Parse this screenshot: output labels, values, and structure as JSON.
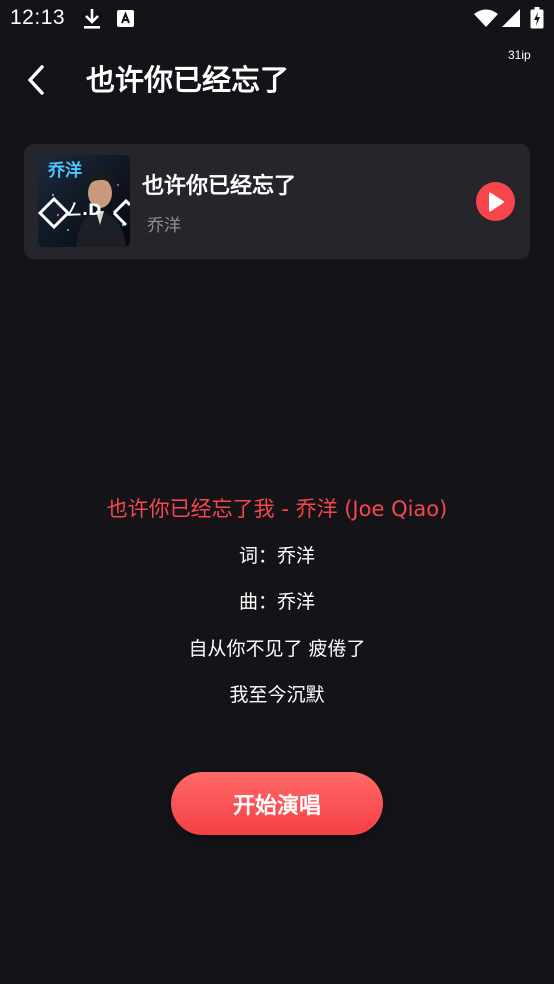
{
  "status_bar": {
    "time": "12:13",
    "network_speed": "31ip",
    "icons": [
      "download-icon",
      "app-notification-icon",
      "wifi-icon",
      "signal-icon",
      "battery-icon"
    ]
  },
  "header": {
    "back_icon": "chevron-left-icon",
    "title": "也许你已经忘了"
  },
  "song_card": {
    "title": "也许你已经忘了",
    "artist": "乔洋",
    "cover_text": "乔洋",
    "play_icon": "play-icon"
  },
  "lyrics": {
    "lines": [
      "也许你已经忘了我 - 乔洋 (Joe Qiao)",
      "词：乔洋",
      "曲：乔洋",
      "自从你不见了 疲倦了",
      "我至今沉默"
    ],
    "current_index": 0
  },
  "start_button": {
    "label": "开始演唱"
  },
  "colors": {
    "background": "#131318",
    "card": "#26252b",
    "accent": "#f5474d",
    "secondary_text": "#8f8e95"
  }
}
